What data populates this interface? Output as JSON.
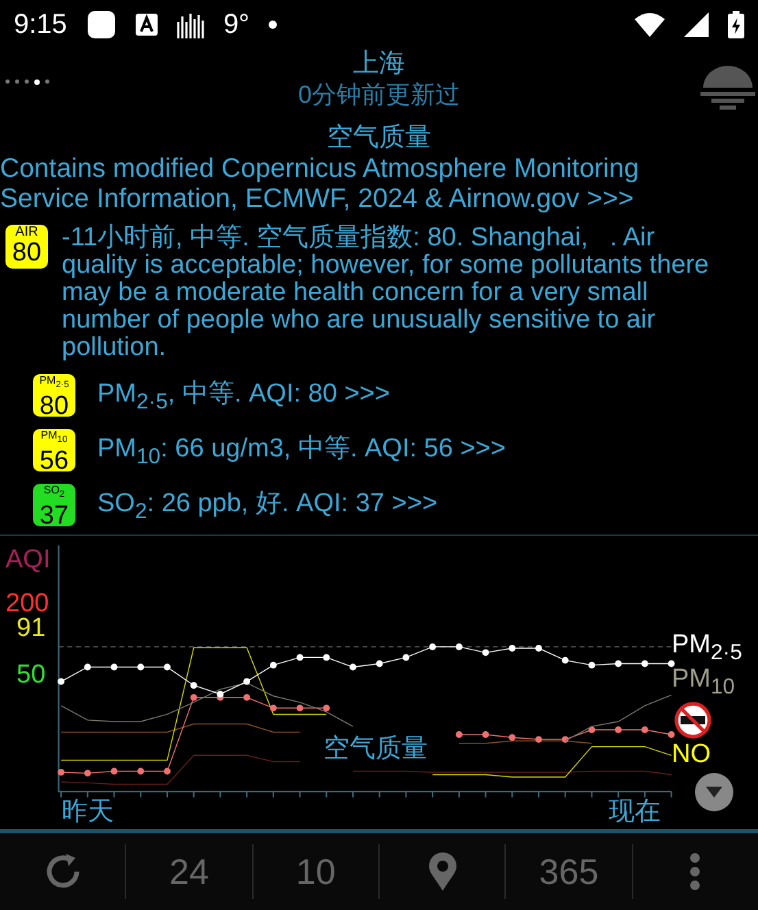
{
  "status_bar": {
    "time": "9:15",
    "temperature": "9°"
  },
  "header": {
    "pages": [
      {
        "selected": false
      },
      {
        "selected": false
      },
      {
        "selected": false
      },
      {
        "selected": true
      },
      {
        "selected": false
      }
    ],
    "city": "上海",
    "updated": "0分钟前更新过"
  },
  "title": "空气质量",
  "attribution": "Contains modified Copernicus Atmosphere Monitoring Service Information, ECMWF, 2024 & Airnow.gov >>>",
  "summary": {
    "badge_label": "AIR",
    "badge_value": "80",
    "color": "#ffff00",
    "text": "-11小时前, 中等. 空气质量指数: 80. Shanghai,   . Air quality is acceptable; however, for some pollutants there may be a moderate health concern for a very small number of people who are unusually sensitive to air pollution."
  },
  "pollutants": [
    {
      "badge_label": "PM$_{2·5}$",
      "badge_value": "80",
      "color": "#ffff00",
      "text": "PM$_{2·5}$, 中等. AQI: 80 >>>"
    },
    {
      "badge_label": "PM$_{10}$",
      "badge_value": "56",
      "color": "#ffff00",
      "text": "PM$_{10}$: 66 ug/m3, 中等. AQI: 56 >>>"
    },
    {
      "badge_label": "SO$_{2}$",
      "badge_value": "37",
      "color": "#22dd22",
      "text": "SO$_{2}$: 26 ppb, 好. AQI: 37 >>>"
    }
  ],
  "chart": {
    "y_title": "AQI",
    "y_labels": [
      "200",
      "91",
      "50"
    ],
    "x_start": "昨天",
    "x_end": "现在",
    "watermark_title": "空气质量",
    "legend": [
      {
        "label": "PM$_{2·5}$",
        "color": "#ffffff"
      },
      {
        "label": "PM$_{10}$",
        "color": "#a09f8c"
      },
      {
        "label": "NO",
        "color": "#ffff00"
      }
    ]
  },
  "bottom_bar": {
    "items": [
      {
        "kind": "refresh"
      },
      {
        "kind": "text",
        "label": "24"
      },
      {
        "kind": "text",
        "label": "10"
      },
      {
        "kind": "location"
      },
      {
        "kind": "text",
        "label": "365"
      },
      {
        "kind": "more"
      }
    ]
  }
}
